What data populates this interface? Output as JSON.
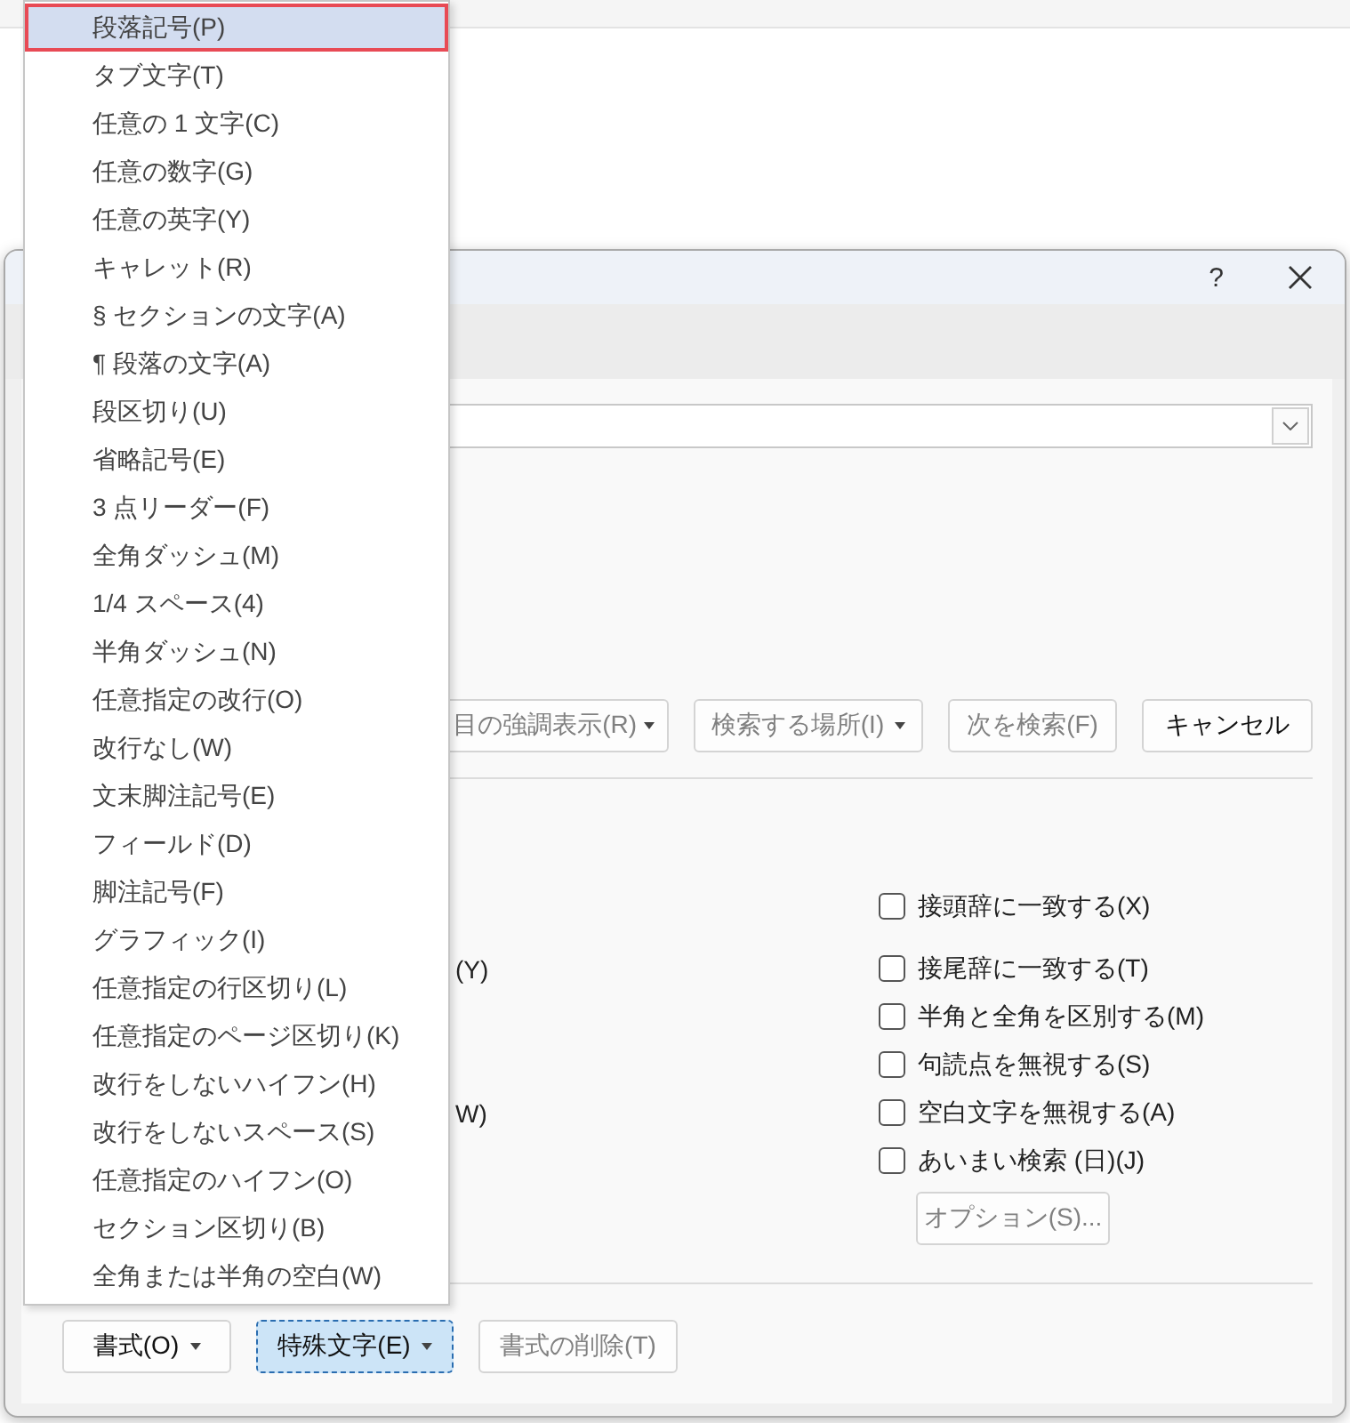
{
  "dialog": {
    "help_button": "?",
    "search_buttons": [
      {
        "label": "目の強調表示(R)",
        "dropdown": true,
        "disabled": true
      },
      {
        "label": "検索する場所(I)",
        "dropdown": true,
        "disabled": true
      },
      {
        "label": "次を検索(F)",
        "dropdown": false,
        "disabled": true
      },
      {
        "label": "キャンセル",
        "dropdown": false,
        "disabled": false
      }
    ],
    "options": [
      {
        "label": "接頭辞に一致する(X)",
        "checked": false
      },
      {
        "label": "接尾辞に一致する(T)",
        "checked": false,
        "left_label": "(Y)"
      },
      {
        "label": "半角と全角を区別する(M)",
        "checked": false
      },
      {
        "label": "句読点を無視する(S)",
        "checked": false
      },
      {
        "label": "空白文字を無視する(A)",
        "checked": false,
        "left_label": "W)"
      },
      {
        "label": "あいまい検索 (日)(J)",
        "checked": false
      }
    ],
    "options_button": {
      "label": "オプション(S)...",
      "disabled": true
    },
    "bottom_buttons": [
      {
        "label": "書式(O)",
        "dropdown": true,
        "disabled": false,
        "active": false
      },
      {
        "label": "特殊文字(E)",
        "dropdown": true,
        "disabled": false,
        "active": true
      },
      {
        "label": "書式の削除(T)",
        "dropdown": false,
        "disabled": true,
        "active": false
      }
    ]
  },
  "menu": {
    "items": [
      {
        "label": "段落記号(P)",
        "selected": true
      },
      {
        "label": "タブ文字(T)",
        "selected": false
      },
      {
        "label": "任意の 1 文字(C)",
        "selected": false
      },
      {
        "label": "任意の数字(G)",
        "selected": false
      },
      {
        "label": "任意の英字(Y)",
        "selected": false
      },
      {
        "label": "キャレット(R)",
        "selected": false
      },
      {
        "label": "§ セクションの文字(A)",
        "selected": false
      },
      {
        "label": "¶ 段落の文字(A)",
        "selected": false
      },
      {
        "label": "段区切り(U)",
        "selected": false
      },
      {
        "label": "省略記号(E)",
        "selected": false
      },
      {
        "label": "3 点リーダー(F)",
        "selected": false
      },
      {
        "label": "全角ダッシュ(M)",
        "selected": false
      },
      {
        "label": "1/4 スペース(4)",
        "selected": false
      },
      {
        "label": "半角ダッシュ(N)",
        "selected": false
      },
      {
        "label": "任意指定の改行(O)",
        "selected": false
      },
      {
        "label": "改行なし(W)",
        "selected": false
      },
      {
        "label": "文末脚注記号(E)",
        "selected": false
      },
      {
        "label": "フィールド(D)",
        "selected": false
      },
      {
        "label": "脚注記号(F)",
        "selected": false
      },
      {
        "label": "グラフィック(I)",
        "selected": false
      },
      {
        "label": "任意指定の行区切り(L)",
        "selected": false
      },
      {
        "label": "任意指定のページ区切り(K)",
        "selected": false
      },
      {
        "label": "改行をしないハイフン(H)",
        "selected": false
      },
      {
        "label": "改行をしないスペース(S)",
        "selected": false
      },
      {
        "label": "任意指定のハイフン(O)",
        "selected": false
      },
      {
        "label": "セクション区切り(B)",
        "selected": false
      },
      {
        "label": "全角または半角の空白(W)",
        "selected": false
      }
    ]
  }
}
